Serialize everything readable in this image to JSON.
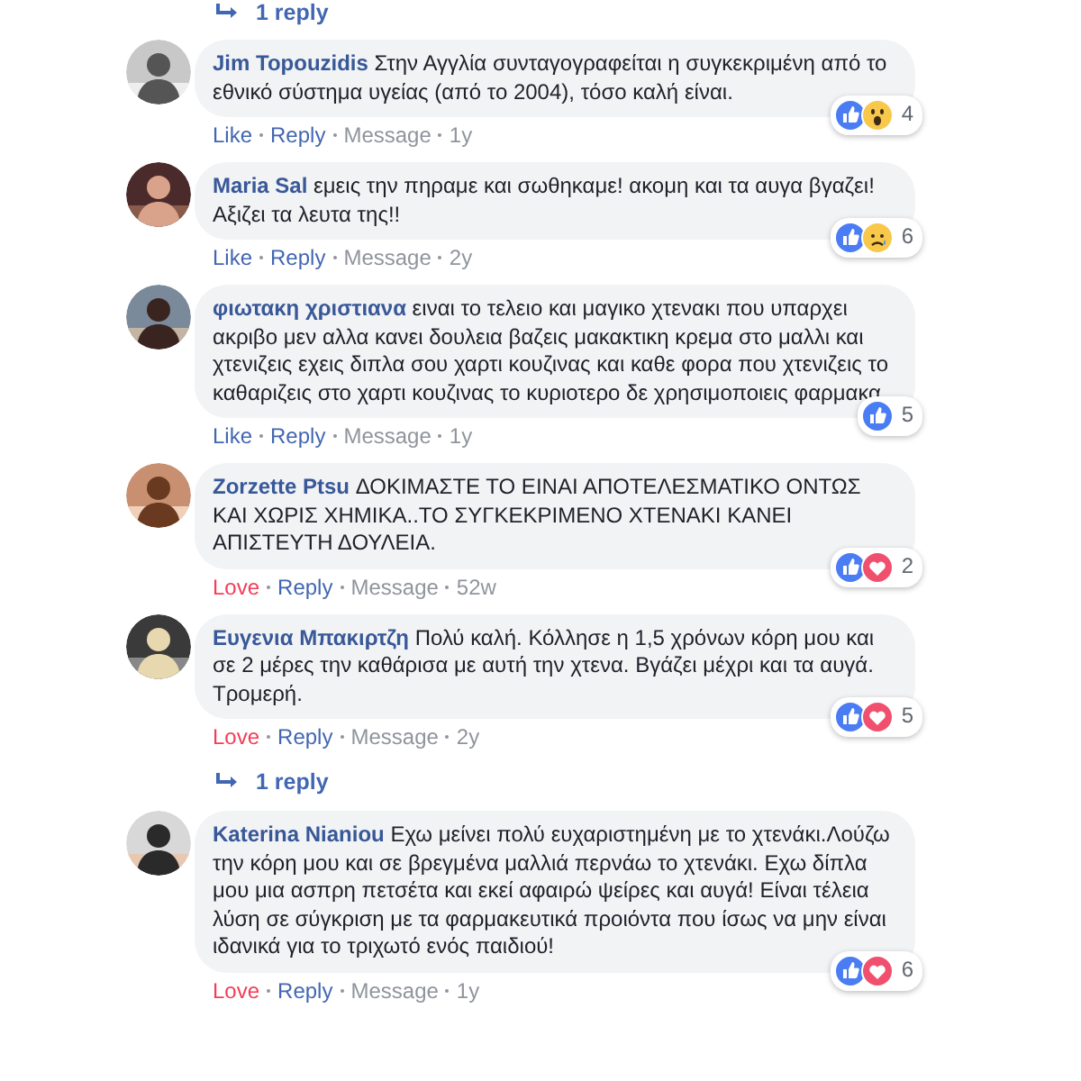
{
  "top_reply": {
    "label": "1 reply"
  },
  "comments": [
    {
      "author": "Jim Topouzidis",
      "text": "Στην Αγγλία συνταγογραφείται η συγκεκριμένη από το εθνικό σύστημα υγείας (από το 2004), τόσο καλή είναι.",
      "action": {
        "label": "Like",
        "kind": "like"
      },
      "reply": "Reply",
      "message": "Message",
      "time": "1y",
      "reactions": [
        {
          "kind": "like"
        },
        {
          "kind": "wow"
        }
      ],
      "count": "4"
    },
    {
      "author": "Maria Sal",
      "text": "εμεις την πηραμε και σωθηκαμε! ακομη και τα αυγα βγαζει! Αξιζει τα λευτα της!!",
      "action": {
        "label": "Like",
        "kind": "like"
      },
      "reply": "Reply",
      "message": "Message",
      "time": "2y",
      "reactions": [
        {
          "kind": "like"
        },
        {
          "kind": "sad"
        }
      ],
      "count": "6"
    },
    {
      "author": "φιωτακη χριστιανα",
      "text": "ειναι το τελειο και μαγικο χτενακι που υπαρχει ακριβο μεν αλλα κανει δουλεια βαζεις μακακτικη κρεμα στο μαλλι και χτενιζεις εχεις διπλα σου χαρτι κουζινας και καθε φορα που χτενιζεις το καθαριζεις στο χαρτι κουζινας το κυριοτερο δε χρησιμοποιεις φαρμακα",
      "action": {
        "label": "Like",
        "kind": "like"
      },
      "reply": "Reply",
      "message": "Message",
      "time": "1y",
      "reactions": [
        {
          "kind": "like"
        }
      ],
      "count": "5"
    },
    {
      "author": "Zorzette Ptsu",
      "text": "ΔΟΚΙΜΑΣΤΕ ΤΟ ΕΙΝΑΙ ΑΠΟΤΕΛΕΣΜΑΤΙΚΟ ΟΝΤΩΣ ΚΑΙ ΧΩΡΙΣ ΧΗΜΙΚΑ..ΤΟ ΣΥΓΚΕΚΡΙΜΕΝΟ ΧΤΕΝΑΚΙ ΚΑΝΕΙ ΑΠΙΣΤΕΥΤΗ ΔΟΥΛΕΙΑ.",
      "action": {
        "label": "Love",
        "kind": "love"
      },
      "reply": "Reply",
      "message": "Message",
      "time": "52w",
      "reactions": [
        {
          "kind": "like"
        },
        {
          "kind": "love"
        }
      ],
      "count": "2"
    },
    {
      "author": "Ευγενια Μπακιρτζη",
      "text": "Πολύ καλή. Κόλλησε η 1,5 χρόνων κόρη μου και σε 2 μέρες την καθάρισα με αυτή την χτενα. Βγάζει μέχρι και τα αυγά. Τρομερή.",
      "action": {
        "label": "Love",
        "kind": "love"
      },
      "reply": "Reply",
      "message": "Message",
      "time": "2y",
      "reactions": [
        {
          "kind": "like"
        },
        {
          "kind": "love"
        }
      ],
      "count": "5",
      "replies_link": "1 reply"
    },
    {
      "author": "Katerina Nianiou",
      "text": "Εχω μείνει πολύ ευχαριστημένη με το χτενάκι.Λούζω την κόρη μου και σε βρεγμένα μαλλιά περνάω το χτενάκι. Εχω δίπλα μου μια ασπρη πετσέτα και εκεί αφαιρώ ψείρες και αυγά! Είναι τέλεια λύση σε σύγκριση με τα φαρμακευτικά προιόντα που ίσως να μην είναι ιδανικά για το τριχωτό ενός παιδιού!",
      "action": {
        "label": "Love",
        "kind": "love"
      },
      "reply": "Reply",
      "message": "Message",
      "time": "1y",
      "reactions": [
        {
          "kind": "like"
        },
        {
          "kind": "love"
        }
      ],
      "count": "6"
    }
  ]
}
